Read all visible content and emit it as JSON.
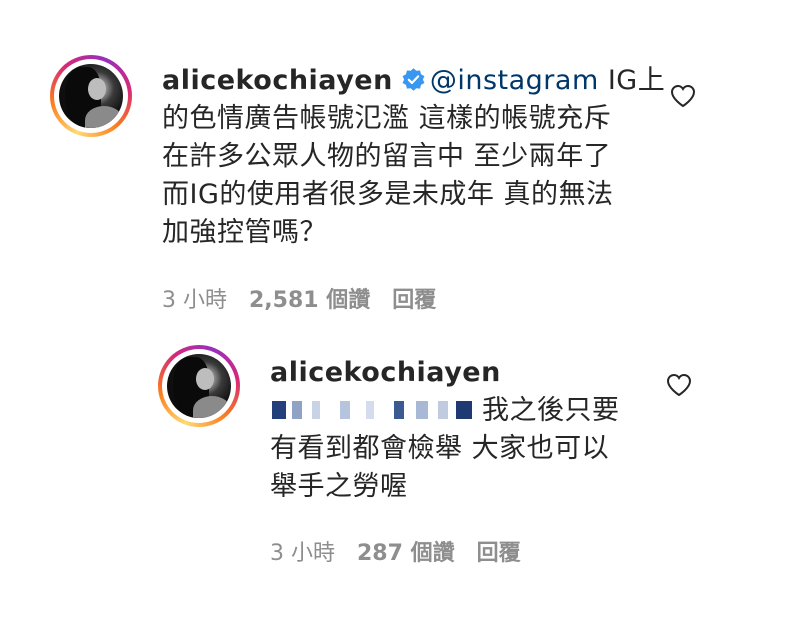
{
  "comments": [
    {
      "username": "alicekochiayen",
      "verified": true,
      "mention": "@instagram",
      "text_line1": " IG上",
      "text_line2": "的色情廣告帳號氾濫 這樣的帳號充斥",
      "text_line3": "在許多公眾人物的留言中 至少兩年了",
      "text_line4": "而IG的使用者很多是未成年 真的無法",
      "text_line5": "加強控管嗎？",
      "time": "3 小時",
      "likes": "2,581 個讚",
      "reply_label": "回覆"
    },
    {
      "username": "alicekochiayen",
      "verified": false,
      "text_line1": "我之後只要",
      "text_line2": "有看到都會檢舉 大家也可以",
      "text_line3": "舉手之勞喔",
      "time": "3 小時",
      "likes": "287 個讚",
      "reply_label": "回覆"
    }
  ],
  "colors": {
    "text": "#262626",
    "meta": "#8e8e8e",
    "mention": "#00376b",
    "verified": "#3897f0"
  },
  "icons": [
    "verified-badge-icon",
    "heart-icon"
  ]
}
